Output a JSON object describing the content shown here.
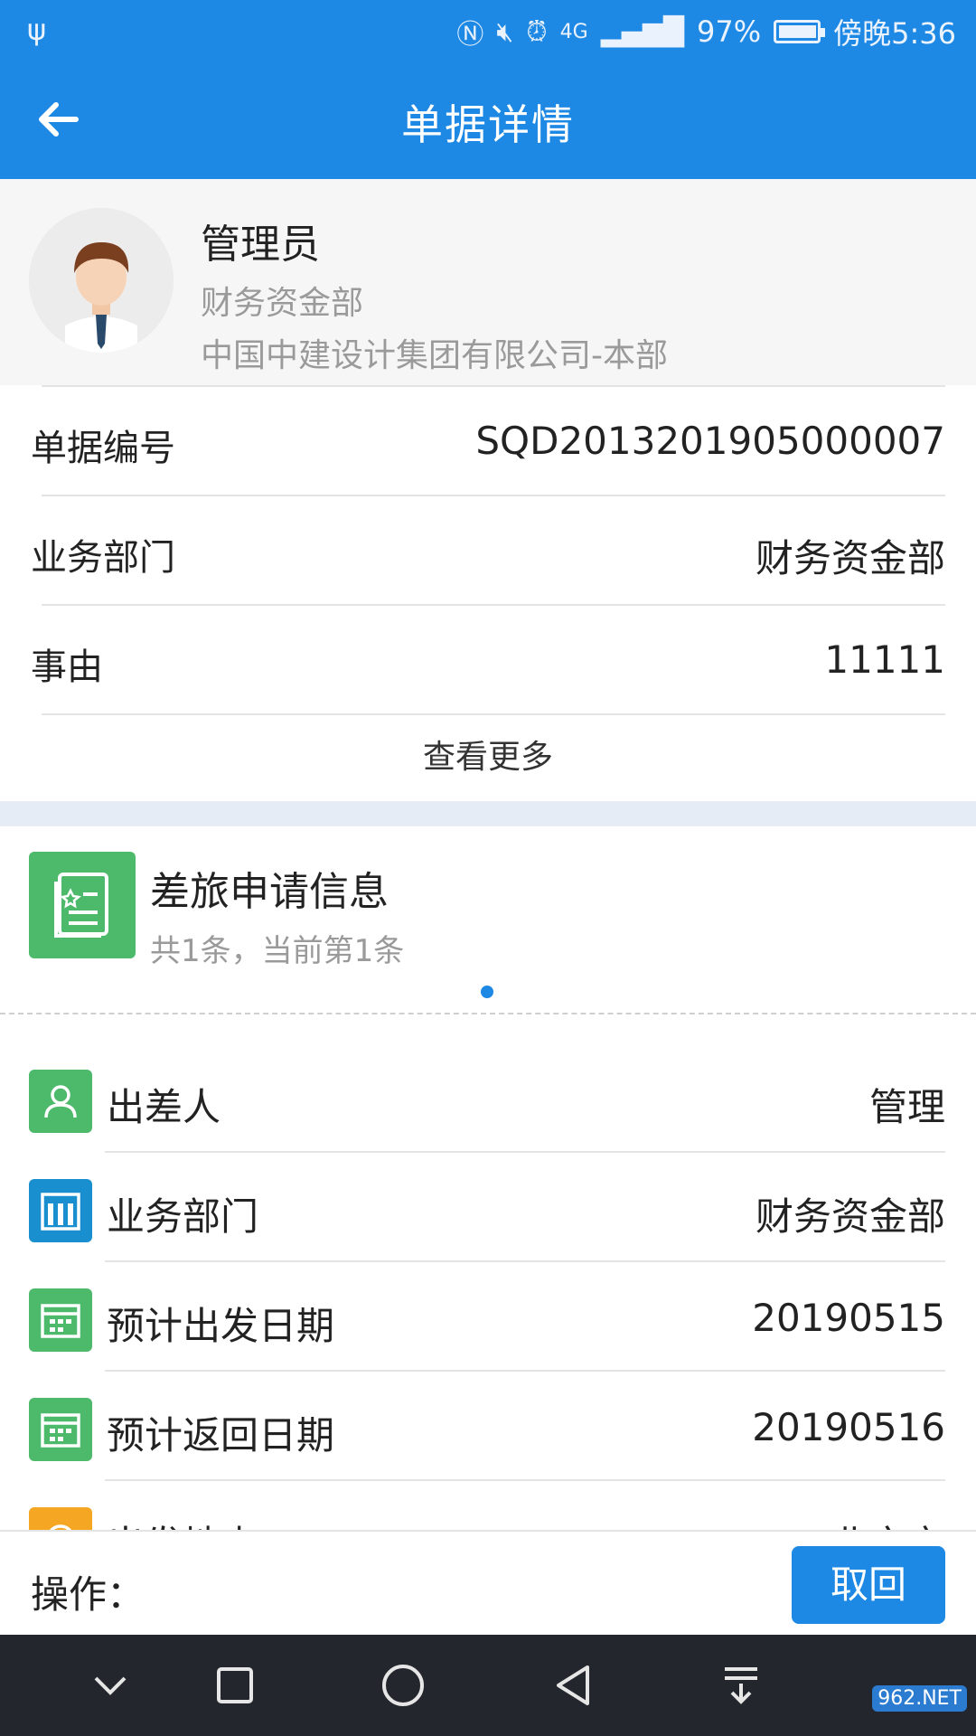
{
  "status_bar": {
    "battery": "97%",
    "battery_level": 0.97,
    "time": "傍晚5:36",
    "network": "4G"
  },
  "header": {
    "title": "单据详情"
  },
  "profile": {
    "name": "管理员",
    "department": "财务资金部",
    "company": "中国中建设计集团有限公司-本部"
  },
  "info_rows": [
    {
      "label": "单据编号",
      "value": "SQD2013201905000007"
    },
    {
      "label": "业务部门",
      "value": "财务资金部"
    },
    {
      "label": "事由",
      "value": "11111"
    }
  ],
  "more_label": "查看更多",
  "section": {
    "title": "差旅申请信息",
    "subtitle": "共1条，当前第1条"
  },
  "detail_rows": [
    {
      "label": "出差人",
      "value": "管理",
      "icon": "person-icon",
      "color": "#4cb96b"
    },
    {
      "label": "业务部门",
      "value": "财务资金部",
      "icon": "department-icon",
      "color": "#1a8fd0"
    },
    {
      "label": "预计出发日期",
      "value": "20190515",
      "icon": "calendar-icon",
      "color": "#4cb96b"
    },
    {
      "label": "预计返回日期",
      "value": "20190516",
      "icon": "calendar-icon",
      "color": "#4cb96b"
    },
    {
      "label": "出发地点",
      "value": "北京市",
      "icon": "location-icon",
      "color": "#f5a623"
    }
  ],
  "action": {
    "label": "操作：",
    "button": "取回"
  },
  "watermark": "962.NET",
  "colors": {
    "primary": "#1e88e5",
    "green": "#4cb96b",
    "nav": "#23262c"
  }
}
